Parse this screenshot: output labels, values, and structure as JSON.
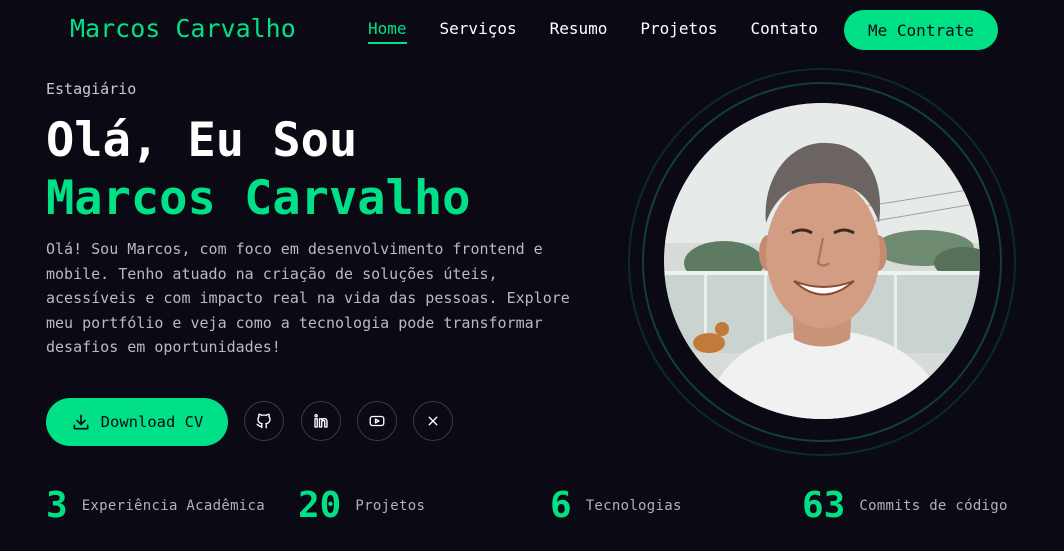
{
  "header": {
    "logo": "Marcos Carvalho",
    "nav": [
      {
        "label": "Home",
        "active": true
      },
      {
        "label": "Serviços",
        "active": false
      },
      {
        "label": "Resumo",
        "active": false
      },
      {
        "label": "Projetos",
        "active": false
      },
      {
        "label": "Contato",
        "active": false
      }
    ],
    "hire_label": "Me Contrate"
  },
  "hero": {
    "role": "Estagiário",
    "greeting": "Olá, Eu Sou",
    "name": "Marcos Carvalho",
    "description": "Olá! Sou Marcos, com foco em desenvolvimento frontend e mobile. Tenho atuado na criação de soluções úteis, acessíveis e com impacto real na vida das pessoas. Explore meu portfólio e veja como a tecnologia pode transformar desafios em oportunidades!",
    "download_label": "Download CV",
    "socials": [
      "github-icon",
      "linkedin-icon",
      "youtube-icon",
      "x-icon"
    ]
  },
  "stats": [
    {
      "value": "3",
      "label": "Experiência Acadêmica"
    },
    {
      "value": "20",
      "label": "Projetos"
    },
    {
      "value": "6",
      "label": "Tecnologias"
    },
    {
      "value": "63",
      "label": "Commits de código"
    }
  ],
  "colors": {
    "background": "#0b0a14",
    "accent": "#00e187",
    "text": "#ffffff",
    "muted": "#b9b9c2"
  }
}
